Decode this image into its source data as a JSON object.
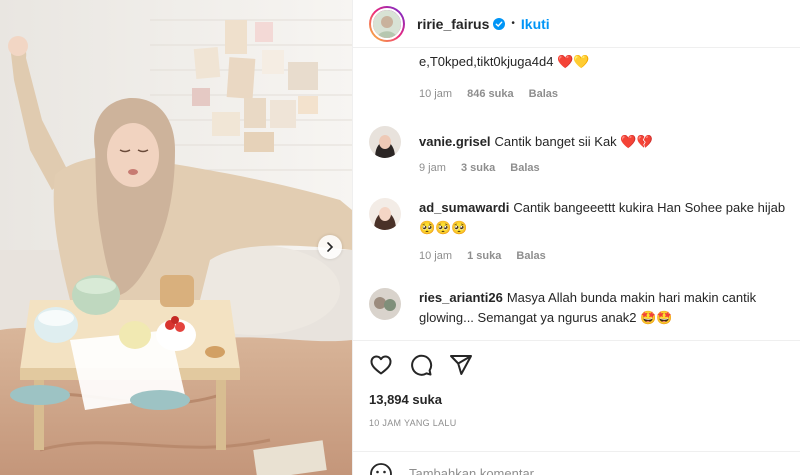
{
  "post": {
    "username": "ririe_fairus",
    "follow_label": "Ikuti",
    "likes": "13,894 suka",
    "time": "10 JAM YANG LALU"
  },
  "comments": [
    {
      "user": "",
      "text": "e,T0kped,tikt0kjuga4d4",
      "emoji": "❤️💛",
      "time": "10 jam",
      "likes": "846 suka",
      "reply": "Balas"
    },
    {
      "user": "vanie.grisel",
      "text": "Cantik banget sii Kak",
      "emoji": "❤️💔",
      "time": "9 jam",
      "likes": "3 suka",
      "reply": "Balas"
    },
    {
      "user": "ad_sumawardi",
      "text": "Cantik bangeeettt kukira Han Sohee pake hijab",
      "emoji": "🥺🥺🥺",
      "time": "10 jam",
      "likes": "1 suka",
      "reply": "Balas"
    },
    {
      "user": "ries_arianti26",
      "text": "Masya Allah bunda makin hari makin cantik glowing... Semangat ya ngurus anak2",
      "emoji": "🤩🤩",
      "time": "",
      "likes": "",
      "reply": ""
    }
  ],
  "composer": {
    "placeholder": "Tambahkan komentar..."
  },
  "colors": {
    "accent": "#0095f6",
    "text": "#262626",
    "muted": "#8e8e8e",
    "divider": "#efefef"
  },
  "icons": {
    "like": "heart-icon",
    "comment": "comment-icon",
    "share": "send-icon",
    "emoji": "smiley-icon",
    "verified": "verified-badge-icon",
    "next": "chevron-right-icon"
  }
}
